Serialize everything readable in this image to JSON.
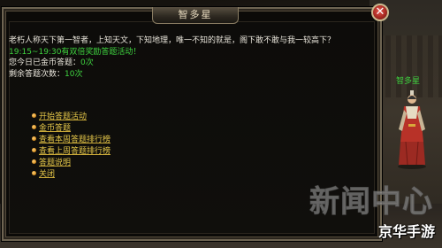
{
  "dialog": {
    "title": "智多星",
    "close_symbol": "✕",
    "lines": [
      "老朽人称天下第一智者，上知天文，下知地理，唯一不知的就是，阁下敢不敢与我一较高下？",
      "19:15~19:30有双倍奖励答题活动！"
    ],
    "gold_count": {
      "label": "您今日已金币答题：",
      "value": "0次"
    },
    "remaining_count": {
      "label": "剩余答题次数：",
      "value": "10次"
    },
    "options": [
      "开始答题活动",
      "金币答题",
      "查看本周答题排行榜",
      "查看上周答题排行榜",
      "答题说明",
      "关闭"
    ]
  },
  "npc": {
    "name": "智多星"
  },
  "watermark": {
    "big": "新闻中心",
    "small": "京华手游"
  },
  "colors": {
    "highlight_green": "#3fd23f",
    "option_gold": "#e6c84a",
    "body_text": "#e8e4da"
  }
}
